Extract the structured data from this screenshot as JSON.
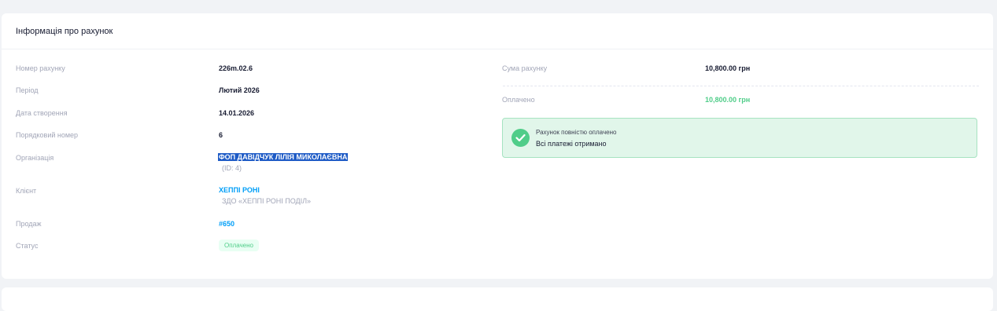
{
  "card": {
    "title": "Інформація про рахунок"
  },
  "details": {
    "invoice_number_label": "Номер рахунку",
    "invoice_number": "226m.02.6",
    "period_label": "Період",
    "period": "Лютий 2026",
    "created_label": "Дата створення",
    "created": "14.01.2026",
    "seq_label": "Порядковий номер",
    "seq": "6",
    "org_label": "Організація",
    "org_name": "ФОП ДАВІДЧУК ЛІЛІЯ МИКОЛАЄВНА",
    "org_id": "(ID: 4)",
    "client_label": "Клієнт",
    "client_name": "ХЕППІ РОНІ",
    "client_sub": "ЗДО «ХЕППІ РОНІ ПОДІЛ»",
    "sale_label": "Продаж",
    "sale": "#650",
    "status_label": "Статус",
    "status": "Оплачено"
  },
  "summary": {
    "amount_label": "Сума рахунку",
    "amount": "10,800.00 грн",
    "paid_label": "Оплачено",
    "paid": "10,800.00 грн"
  },
  "notice": {
    "title": "Рахунок повністю оплачено",
    "text": "Всі платежі отримано",
    "icon": "check-circle-icon"
  },
  "colors": {
    "success": "#50cd89",
    "link": "#009ef7",
    "selection": "#1e5bc6"
  }
}
